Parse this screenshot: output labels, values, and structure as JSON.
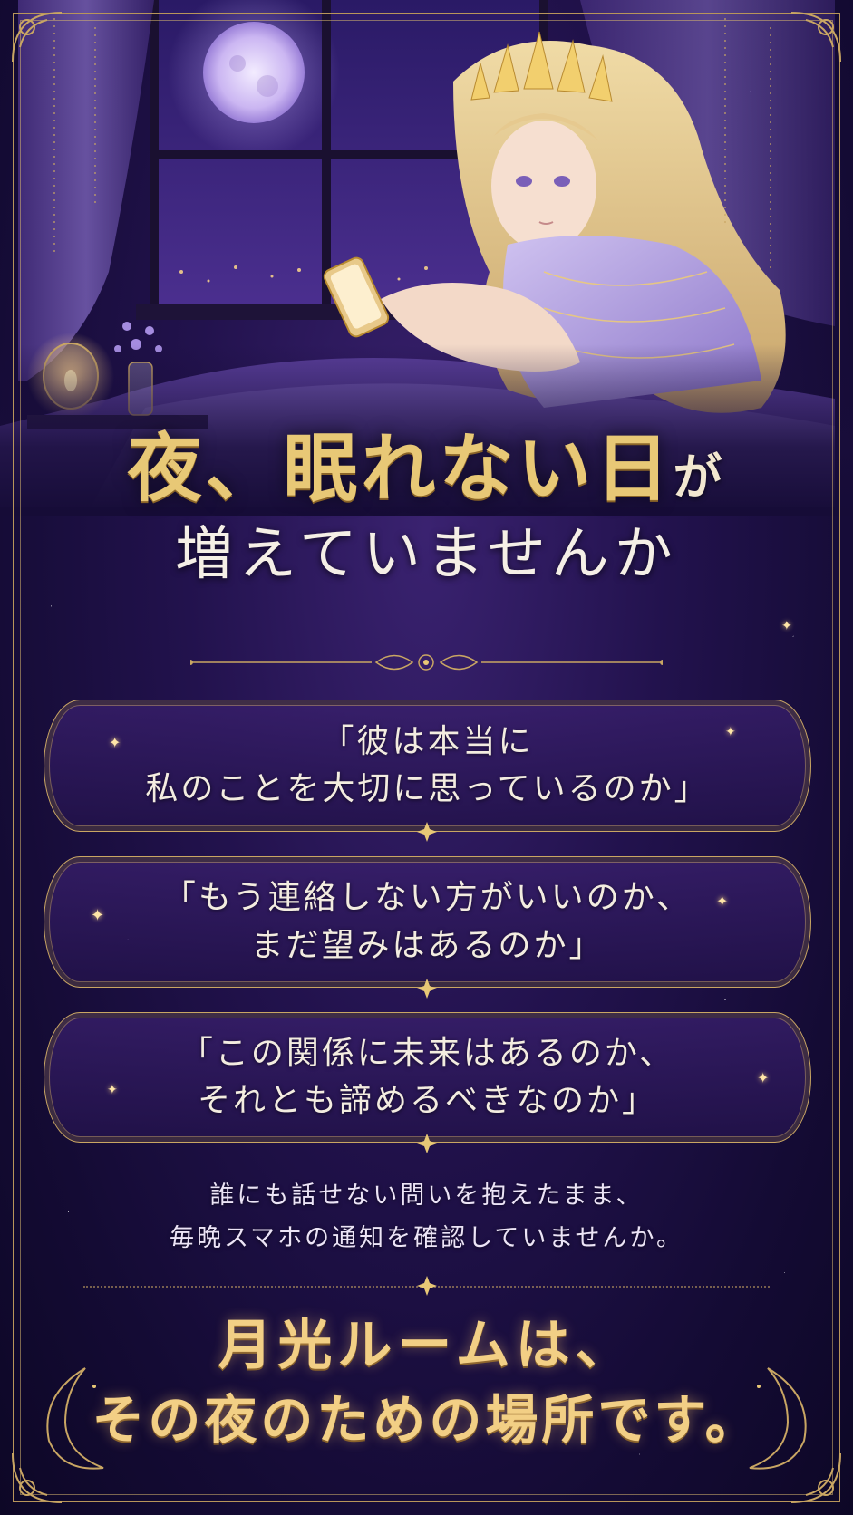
{
  "headline": {
    "line1_main": "夜、眠れない日",
    "line1_suffix": "が",
    "line2": "増えていませんか"
  },
  "quotes": [
    {
      "line1": "「彼は本当に",
      "line2": "私のことを大切に思っているのか」"
    },
    {
      "line1": "「もう連絡しない方がいいのか、",
      "line2": "まだ望みはあるのか」"
    },
    {
      "line1": "「この関係に未来はあるのか、",
      "line2": "それとも諦めるべきなのか」"
    }
  ],
  "body": {
    "line1": "誰にも話せない問いを抱えたまま、",
    "line2": "毎晩スマホの通知を確認していませんか。"
  },
  "closing": {
    "line1": "月光ルームは、",
    "line2": "その夜のための場所です。"
  },
  "colors": {
    "background": "#1a0e3e",
    "gold": "#c9a663",
    "headline_gold": "#e8c876",
    "text": "#f3ece0"
  },
  "illustration": {
    "icon": "night-window-woman-with-phone-illustration"
  }
}
